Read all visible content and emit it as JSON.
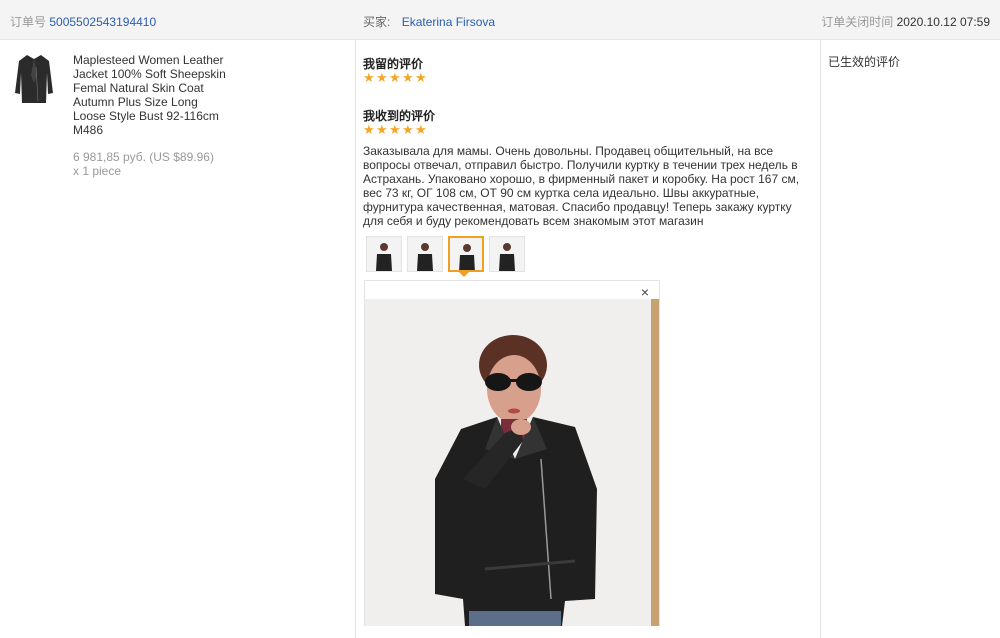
{
  "header": {
    "order_label": "订单号",
    "order_number": "5005502543194410",
    "buyer_label": "买家:",
    "buyer_name": "Ekaterina Firsova",
    "closed_label": "订单关闭时间",
    "closed_time": "2020.10.12 07:59"
  },
  "product": {
    "icon": "leather-jacket-thumbnail",
    "title": "Maplesteed Women Leather Jacket 100% Soft Sheepskin Femal Natural Skin Coat Autumn Plus Size Long Loose Style Bust 92-116cm M486",
    "price": "6 981,85 руб. (US $89.96)",
    "quantity": "x 1 piece"
  },
  "my_review": {
    "title": "我留的评价",
    "rating": 5
  },
  "received_review": {
    "title": "我收到的评价",
    "rating": 5,
    "text": "Заказывала для мамы. Очень довольны. Продавец общительный, на все вопросы отвечал, отправил быстро. Получили куртку в течении трех недель в Астрахань. Упаковано хорошо, в фирменный пакет и коробку. На рост 167 см, вес 73 кг, ОГ 108 см, ОТ 90 см куртка села идеально. Швы аккуратные, фурнитура качественная, матовая. Спасибо продавцу! Теперь закажу куртку для себя и буду рекомендовать всем знакомым этот магазин",
    "photo_count": 4,
    "selected_photo": 3
  },
  "viewer": {
    "close_symbol": "×"
  },
  "status": "已生效的评价",
  "colors": {
    "link": "#2a5db0",
    "star": "#f5a623",
    "selected_border": "#f0a020"
  }
}
